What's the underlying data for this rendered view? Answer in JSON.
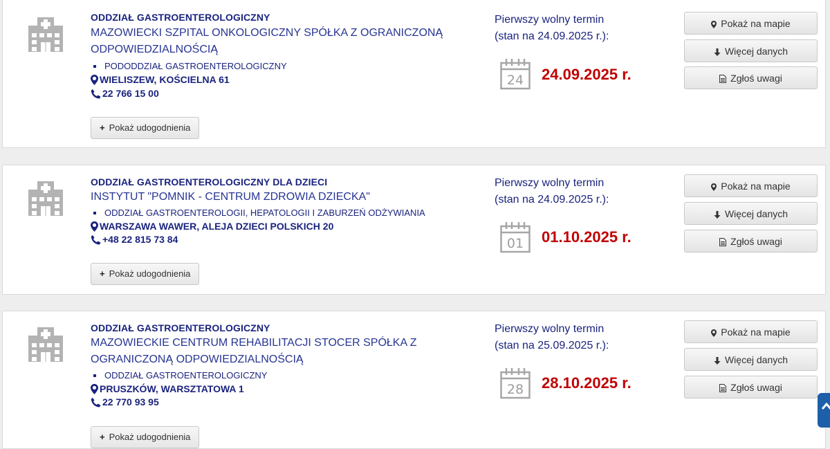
{
  "results": [
    {
      "ward": "ODDZIAŁ GASTROENTEROLOGICZNY",
      "facility": "MAZOWIECKI SZPITAL ONKOLOGICZNY SPÓŁKA Z OGRANICZONĄ ODPOWIEDZIALNOŚCIĄ",
      "subunit": "PODODDZIAŁ GASTROENTEROLOGICZNY",
      "address": "WIELISZEW, KOŚCIELNA 61",
      "phone": "22 766 15 00",
      "amenities_label": "Pokaż udogodnienia",
      "term_label_line1": "Pierwszy wolny termin",
      "term_label_line2": "(stan na 24.09.2025 r.):",
      "calendar_day": "24",
      "term_date": "24.09.2025 r.",
      "btn_map": "Pokaż na mapie",
      "btn_more": "Więcej danych",
      "btn_report": "Zgłoś uwagi"
    },
    {
      "ward": "ODDZIAŁ GASTROENTEROLOGICZNY DLA DZIECI",
      "facility": "INSTYTUT \"POMNIK - CENTRUM ZDROWIA DZIECKA\"",
      "subunit": "ODDZIAŁ GASTROENTEROLOGII, HEPATOLOGII I ZABURZEŃ ODŻYWIANIA",
      "address": "WARSZAWA WAWER, ALEJA DZIECI POLSKICH 20",
      "phone": "+48 22 815 73 84",
      "amenities_label": "Pokaż udogodnienia",
      "term_label_line1": "Pierwszy wolny termin",
      "term_label_line2": "(stan na 24.09.2025 r.):",
      "calendar_day": "01",
      "term_date": "01.10.2025 r.",
      "btn_map": "Pokaż na mapie",
      "btn_more": "Więcej danych",
      "btn_report": "Zgłoś uwagi"
    },
    {
      "ward": "ODDZIAŁ GASTROENTEROLOGICZNY",
      "facility": "MAZOWIECKIE CENTRUM REHABILITACJI STOCER SPÓŁKA Z OGRANICZONĄ ODPOWIEDZIALNOŚCIĄ",
      "subunit": "ODDZIAŁ GASTROENTEROLOGICZNY",
      "address": "PRUSZKÓW, WARSZTATOWA 1",
      "phone": "22 770 93 95",
      "amenities_label": "Pokaż udogodnienia",
      "term_label_line1": "Pierwszy wolny termin",
      "term_label_line2": "(stan na 25.09.2025 r.):",
      "calendar_day": "28",
      "term_date": "28.10.2025 r.",
      "btn_map": "Pokaż na mapie",
      "btn_more": "Więcej danych",
      "btn_report": "Zgłoś uwagi"
    }
  ],
  "colors": {
    "accent_text": "#1a237e",
    "date_red": "#c00000",
    "scroll_button": "#1d5fa8"
  }
}
